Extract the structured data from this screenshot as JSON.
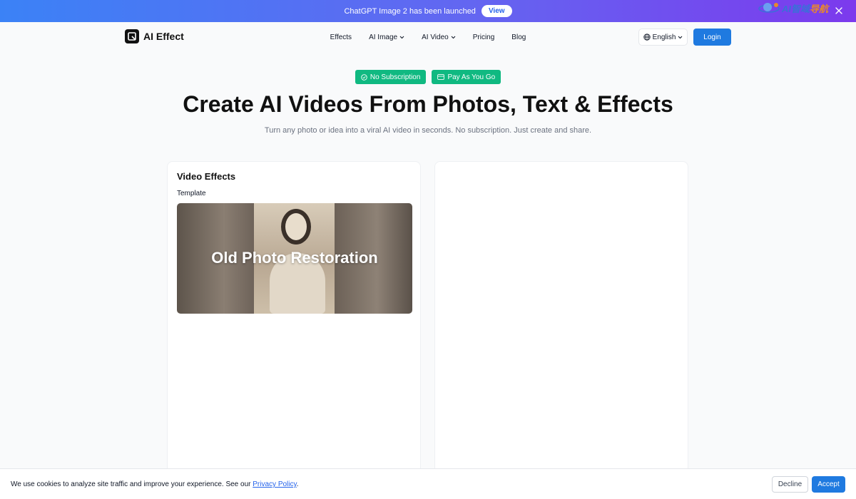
{
  "announcement": {
    "message": "ChatGPT Image 2 has been launched",
    "button_label": "View",
    "close_icon": "close-icon"
  },
  "header": {
    "logo_text": "AI Effect",
    "nav": [
      {
        "label": "Effects",
        "has_dropdown": false
      },
      {
        "label": "AI Image",
        "has_dropdown": true
      },
      {
        "label": "AI Video",
        "has_dropdown": true
      },
      {
        "label": "Pricing",
        "has_dropdown": false
      },
      {
        "label": "Blog",
        "has_dropdown": false
      }
    ],
    "language": "English",
    "login_label": "Login",
    "watermark": {
      "latin": "AI",
      "cjk_1": "智域",
      "cjk_2": "导航"
    }
  },
  "hero": {
    "badges": [
      {
        "label": "No Subscription",
        "icon": "check-circle-icon"
      },
      {
        "label": "Pay As You Go",
        "icon": "credit-card-icon"
      }
    ],
    "title": "Create AI Videos From Photos, Text & Effects",
    "subtitle": "Turn any photo or idea into a viral AI video in seconds. No subscription. Just create and share."
  },
  "panel": {
    "title": "Video Effects",
    "template_label": "Template",
    "template_name": "Old Photo Restoration"
  },
  "cookie": {
    "text": "We use cookies to analyze site traffic and improve your experience. See our ",
    "link": "Privacy Policy",
    "suffix": ".",
    "decline_label": "Decline",
    "accept_label": "Accept"
  },
  "colors": {
    "accent_blue": "#1f7ae0",
    "badge_green": "#10b981",
    "banner_start": "#3b82f6",
    "banner_end": "#7c3aed"
  }
}
